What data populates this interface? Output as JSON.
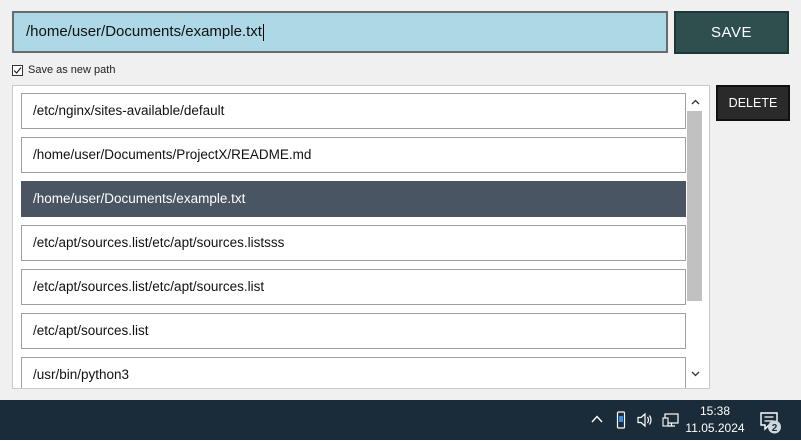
{
  "path_input": {
    "value": "/home/user/Documents/example.txt"
  },
  "save_button": {
    "label": "SAVE"
  },
  "save_as_new": {
    "label": "Save as new path",
    "checked": true
  },
  "path_list": {
    "items": [
      "/etc/nginx/sites-available/default",
      "/home/user/Documents/ProjectX/README.md",
      "/home/user/Documents/example.txt",
      "/etc/apt/sources.list/etc/apt/sources.listsss",
      "/etc/apt/sources.list/etc/apt/sources.list",
      "/etc/apt/sources.list",
      "/usr/bin/python3"
    ],
    "selected_index": 2
  },
  "delete_button": {
    "label": "DELETE"
  },
  "taskbar": {
    "time": "15:38",
    "date": "11.05.2024",
    "notification_count": "2",
    "icons": [
      "chevron-up-icon",
      "usb-device-icon",
      "speaker-icon",
      "network-icon",
      "notification-icon"
    ]
  },
  "colors": {
    "input_bg": "#add8e6",
    "save_bg": "#2f4f4f",
    "selected_bg": "#4a5563",
    "taskbar_bg": "#1a2b3a"
  }
}
